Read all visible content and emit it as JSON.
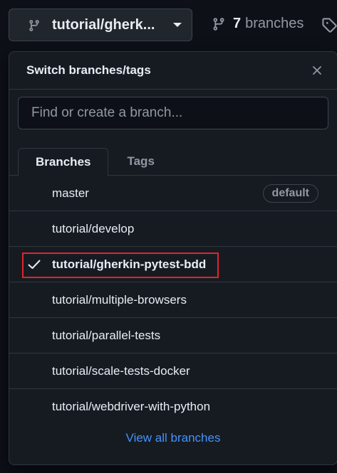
{
  "header": {
    "current_branch": "tutorial/gherk...",
    "branch_count": "7",
    "branches_label": "branches",
    "accent_color": "#4493f8"
  },
  "dropdown": {
    "title": "Switch branches/tags",
    "filter_placeholder": "Find or create a branch...",
    "tabs": [
      {
        "label": "Branches",
        "active": true
      },
      {
        "label": "Tags",
        "active": false
      }
    ],
    "branches": [
      {
        "name": "master",
        "badge": "default",
        "selected": false
      },
      {
        "name": "tutorial/develop",
        "badge": "",
        "selected": false
      },
      {
        "name": "tutorial/gherkin-pytest-bdd",
        "badge": "",
        "selected": true
      },
      {
        "name": "tutorial/multiple-browsers",
        "badge": "",
        "selected": false
      },
      {
        "name": "tutorial/parallel-tests",
        "badge": "",
        "selected": false
      },
      {
        "name": "tutorial/scale-tests-docker",
        "badge": "",
        "selected": false
      },
      {
        "name": "tutorial/webdriver-with-python",
        "badge": "",
        "selected": false
      }
    ],
    "footer_link": "View all branches",
    "highlight_color": "#e5232b"
  }
}
